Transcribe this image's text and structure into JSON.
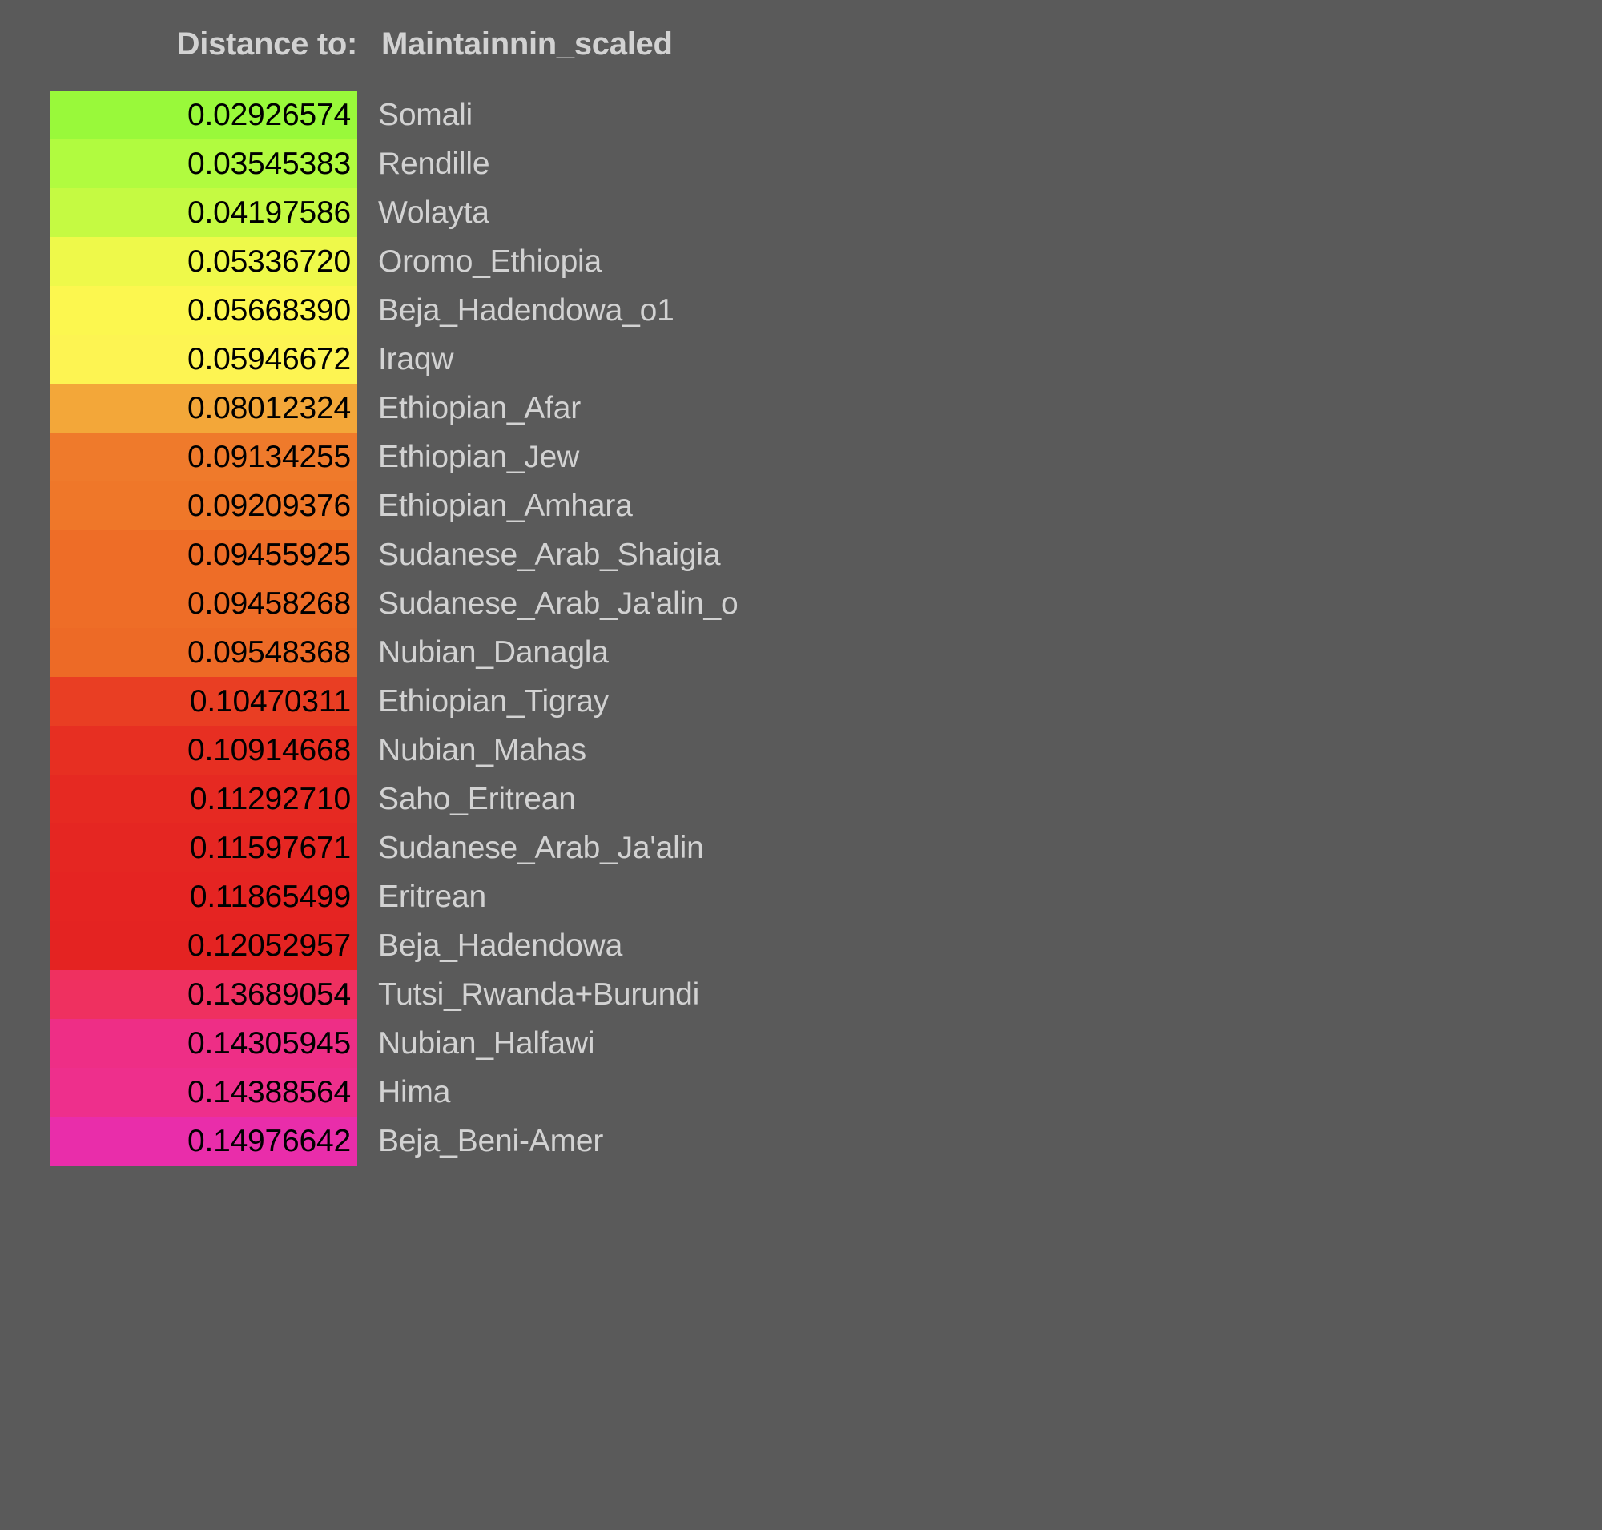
{
  "header": {
    "distance_label": "Distance to:",
    "target": "Maintainnin_scaled"
  },
  "colors": {
    "background": "#5a5a5a",
    "value_text": "#000000",
    "label_text": "#d2d2d2",
    "header_text": "#d2d2d2"
  },
  "chart_data": {
    "type": "table",
    "title": "Distance to: Maintainnin_scaled",
    "xlabel": "",
    "ylabel": "",
    "columns": [
      "distance",
      "population"
    ],
    "categories": [
      "Somali",
      "Rendille",
      "Wolayta",
      "Oromo_Ethiopia",
      "Beja_Hadendowa_o1",
      "Iraqw",
      "Ethiopian_Afar",
      "Ethiopian_Jew",
      "Ethiopian_Amhara",
      "Sudanese_Arab_Shaigia",
      "Sudanese_Arab_Ja'alin_o",
      "Nubian_Danagla",
      "Ethiopian_Tigray",
      "Nubian_Mahas",
      "Saho_Eritrean",
      "Sudanese_Arab_Ja'alin",
      "Eritrean",
      "Beja_Hadendowa",
      "Tutsi_Rwanda+Burundi",
      "Nubian_Halfawi",
      "Hima",
      "Beja_Beni-Amer"
    ],
    "values": [
      0.02926574,
      0.03545383,
      0.04197586,
      0.0533672,
      0.0566839,
      0.05946672,
      0.08012324,
      0.09134255,
      0.09209376,
      0.09455925,
      0.09458268,
      0.09548368,
      0.10470311,
      0.10914668,
      0.1129271,
      0.11597671,
      0.11865499,
      0.12052957,
      0.13689054,
      0.14305945,
      0.14388564,
      0.14976642
    ]
  },
  "rows": [
    {
      "value": "0.02926574",
      "label": "Somali",
      "color": "#99f93a"
    },
    {
      "value": "0.03545383",
      "label": "Rendille",
      "color": "#b1fb3f"
    },
    {
      "value": "0.04197586",
      "label": "Wolayta",
      "color": "#c5fa42"
    },
    {
      "value": "0.05336720",
      "label": "Oromo_Ethiopia",
      "color": "#eef94a"
    },
    {
      "value": "0.05668390",
      "label": "Beja_Hadendowa_o1",
      "color": "#fcf74f"
    },
    {
      "value": "0.05946672",
      "label": "Iraqw",
      "color": "#fdf452"
    },
    {
      "value": "0.08012324",
      "label": "Ethiopian_Afar",
      "color": "#f3a739"
    },
    {
      "value": "0.09134255",
      "label": "Ethiopian_Jew",
      "color": "#ef7a2b"
    },
    {
      "value": "0.09209376",
      "label": "Ethiopian_Amhara",
      "color": "#ef7729"
    },
    {
      "value": "0.09455925",
      "label": "Sudanese_Arab_Shaigia",
      "color": "#ee6d27"
    },
    {
      "value": "0.09458268",
      "label": "Sudanese_Arab_Ja'alin_o",
      "color": "#ee6d27"
    },
    {
      "value": "0.09548368",
      "label": "Nubian_Danagla",
      "color": "#ed6a26"
    },
    {
      "value": "0.10470311",
      "label": "Ethiopian_Tigray",
      "color": "#e93e23"
    },
    {
      "value": "0.10914668",
      "label": "Nubian_Mahas",
      "color": "#e72f22"
    },
    {
      "value": "0.11292710",
      "label": "Saho_Eritrean",
      "color": "#e62922"
    },
    {
      "value": "0.11597671",
      "label": "Sudanese_Arab_Ja'alin",
      "color": "#e52622"
    },
    {
      "value": "0.11865499",
      "label": "Eritrean",
      "color": "#e52422"
    },
    {
      "value": "0.12052957",
      "label": "Beja_Hadendowa",
      "color": "#e42322"
    },
    {
      "value": "0.13689054",
      "label": "Tutsi_Rwanda+Burundi",
      "color": "#ef3060"
    },
    {
      "value": "0.14305945",
      "label": "Nubian_Halfawi",
      "color": "#ee2e86"
    },
    {
      "value": "0.14388564",
      "label": "Hima",
      "color": "#ee2f8c"
    },
    {
      "value": "0.14976642",
      "label": "Beja_Beni-Amer",
      "color": "#e92daa"
    }
  ]
}
